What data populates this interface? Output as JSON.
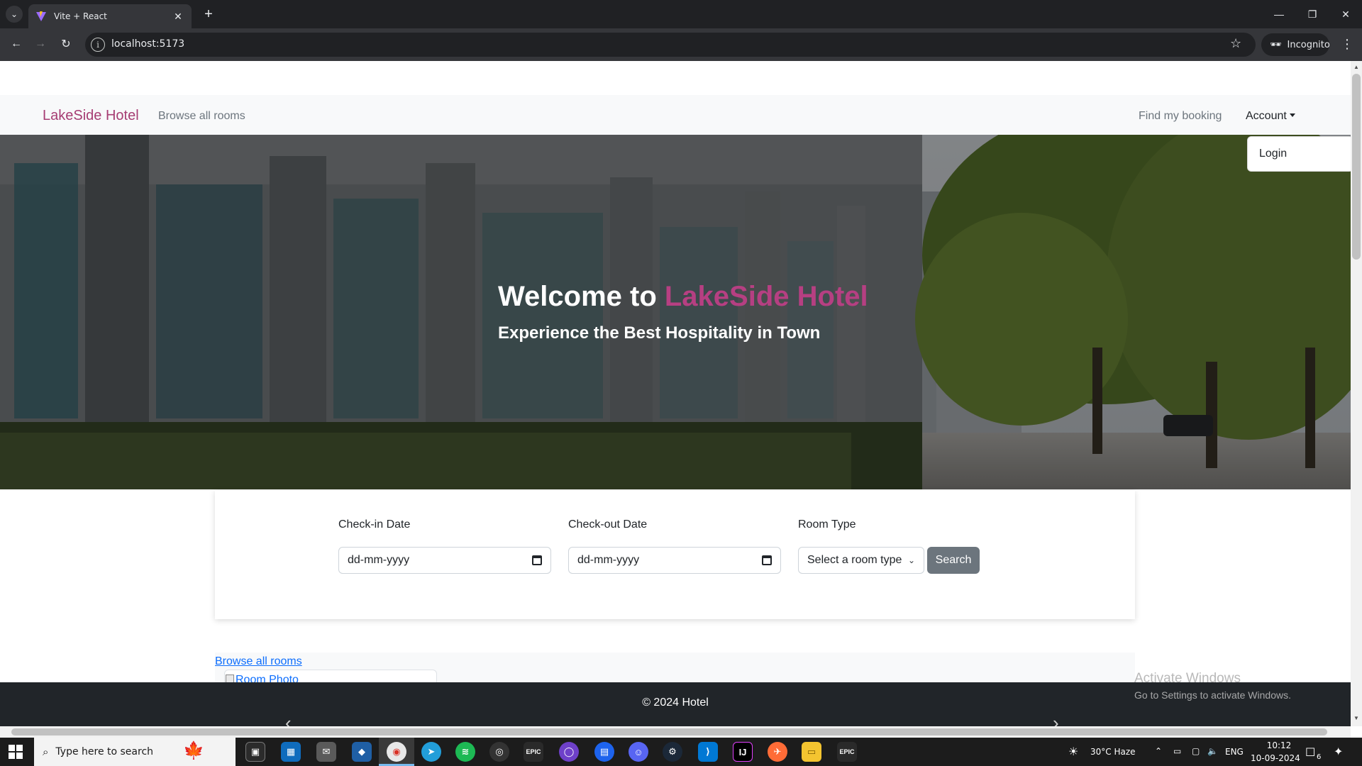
{
  "browser": {
    "tab_title": "Vite + React",
    "url": "localhost:5173",
    "incognito_label": "Incognito",
    "icons": {
      "tab_list": "chevron-down-icon",
      "close_tab": "close-icon",
      "new_tab": "plus-icon",
      "back": "arrow-left-icon",
      "forward": "arrow-right-icon",
      "reload": "reload-icon",
      "site_info": "info-icon",
      "bookmark": "star-icon",
      "menu": "kebab-icon"
    }
  },
  "navbar": {
    "brand": "LakeSide Hotel",
    "browse_link": "Browse all rooms",
    "find_booking": "Find my booking",
    "account": "Account",
    "dropdown_login": "Login"
  },
  "hero": {
    "title_prefix": "Welcome to ",
    "title_accent": "LakeSide Hotel",
    "subtitle": "Experience the Best Hospitality in Town"
  },
  "search": {
    "checkin_label": "Check-in Date",
    "checkin_placeholder": "dd-mm-yyyy",
    "checkout_label": "Check-out Date",
    "checkout_placeholder": "dd-mm-yyyy",
    "roomtype_label": "Room Type",
    "roomtype_selected": "Select a room type",
    "button": "Search"
  },
  "rooms": {
    "browse_link": "Browse all rooms",
    "photo_alt": "Room Photo"
  },
  "footer": {
    "text": "© 2024 Hotel",
    "prev": "‹",
    "next": "›"
  },
  "watermark": {
    "line1": "Activate Windows",
    "line2": "Go to Settings to activate Windows."
  },
  "taskbar": {
    "search_placeholder": "Type here to search",
    "weather": "30°C  Haze",
    "language": "ENG",
    "time": "10:12",
    "date": "10-09-2024",
    "notification_count": "6"
  },
  "colors": {
    "brand": "#a63d73",
    "accent": "#b63f82",
    "search_button": "#6c757d",
    "footer_bg": "#212529",
    "link": "#0d6efd"
  }
}
